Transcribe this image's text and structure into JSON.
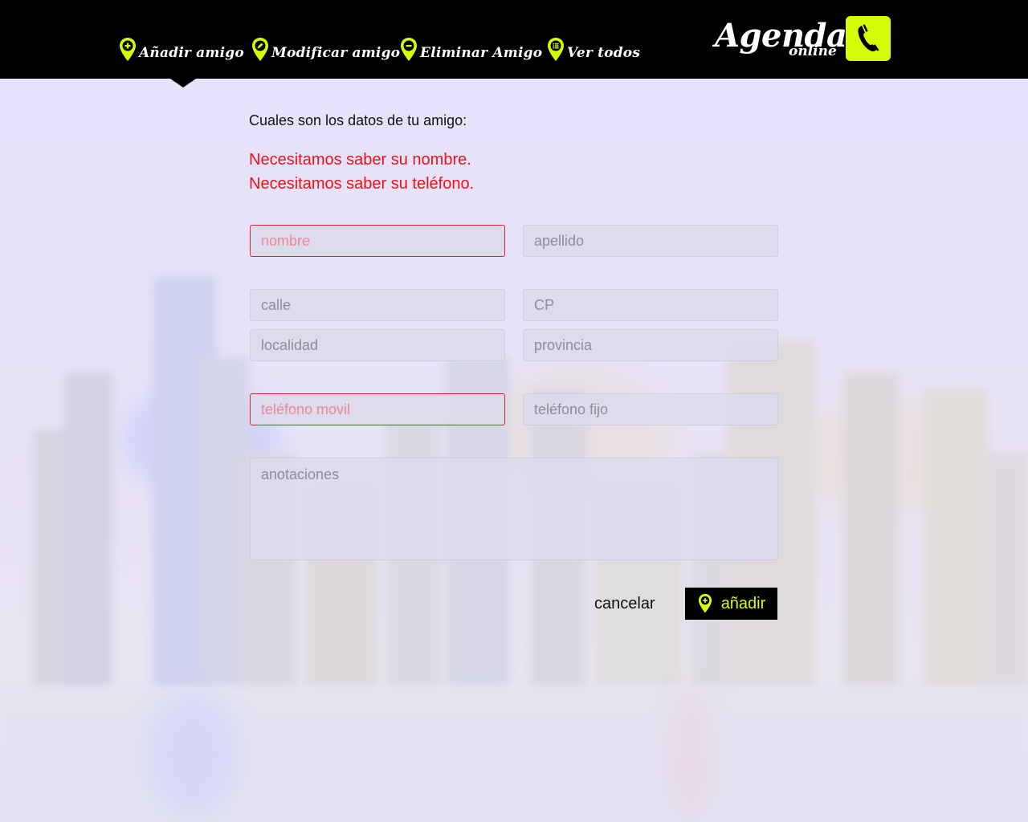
{
  "nav": {
    "items": [
      {
        "label": "Añadir amigo",
        "icon": "plus-pin-icon"
      },
      {
        "label": "Modificar amigo",
        "icon": "pencil-pin-icon"
      },
      {
        "label": "Eliminar Amigo",
        "icon": "minus-pin-icon"
      },
      {
        "label": "Ver todos",
        "icon": "list-pin-icon"
      }
    ]
  },
  "logo": {
    "title": "Agenda",
    "subtitle": "online",
    "icon": "phone-icon"
  },
  "form": {
    "intro": "Cuales son los datos de tu amigo:",
    "errors": [
      "Necesitamos saber su nombre.",
      "Necesitamos saber su teléfono."
    ],
    "fields": {
      "nombre": {
        "placeholder": "nombre",
        "value": "",
        "invalid": true
      },
      "apellido": {
        "placeholder": "apellido",
        "value": ""
      },
      "calle": {
        "placeholder": "calle",
        "value": ""
      },
      "cp": {
        "placeholder": "CP",
        "value": ""
      },
      "localidad": {
        "placeholder": "localidad",
        "value": ""
      },
      "provincia": {
        "placeholder": "provincia",
        "value": ""
      },
      "telefono_movil": {
        "placeholder": "teléfono movil",
        "value": "",
        "invalid": true
      },
      "telefono_fijo": {
        "placeholder": "teléfono fijo",
        "value": ""
      },
      "anotaciones": {
        "placeholder": "anotaciones",
        "value": ""
      }
    },
    "cancel_label": "cancelar",
    "submit_label": "añadir"
  },
  "colors": {
    "accent": "#d5fc09",
    "error": "#ee1111",
    "header": "#000000"
  }
}
